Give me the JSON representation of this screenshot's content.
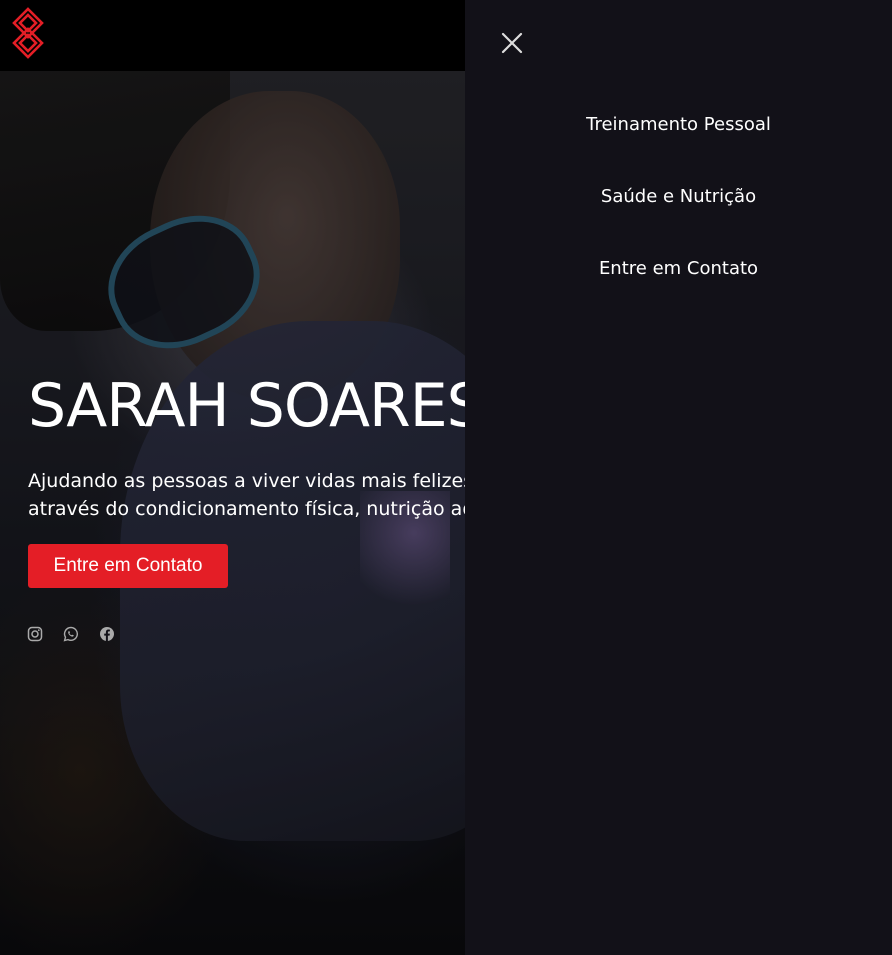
{
  "header": {
    "logo_icon": "s-monogram-logo-icon",
    "logo_color": "#e41e26",
    "background": "#000000"
  },
  "hero": {
    "title": "SARAH SOARES",
    "subtitle": "Ajudando as pessoas a viver vidas mais felizes e saudáveis através do condicionamento física, nutrição adequada e",
    "cta_label": "Entre em Contato",
    "cta_color": "#e41e26",
    "socials": [
      {
        "icon": "instagram-icon"
      },
      {
        "icon": "whatsapp-icon"
      },
      {
        "icon": "facebook-icon"
      }
    ]
  },
  "menu": {
    "close_icon": "close-icon",
    "background": "#121118",
    "items": [
      {
        "label": "Treinamento Pessoal"
      },
      {
        "label": "Saúde e Nutrição"
      },
      {
        "label": "Entre em Contato"
      }
    ]
  }
}
